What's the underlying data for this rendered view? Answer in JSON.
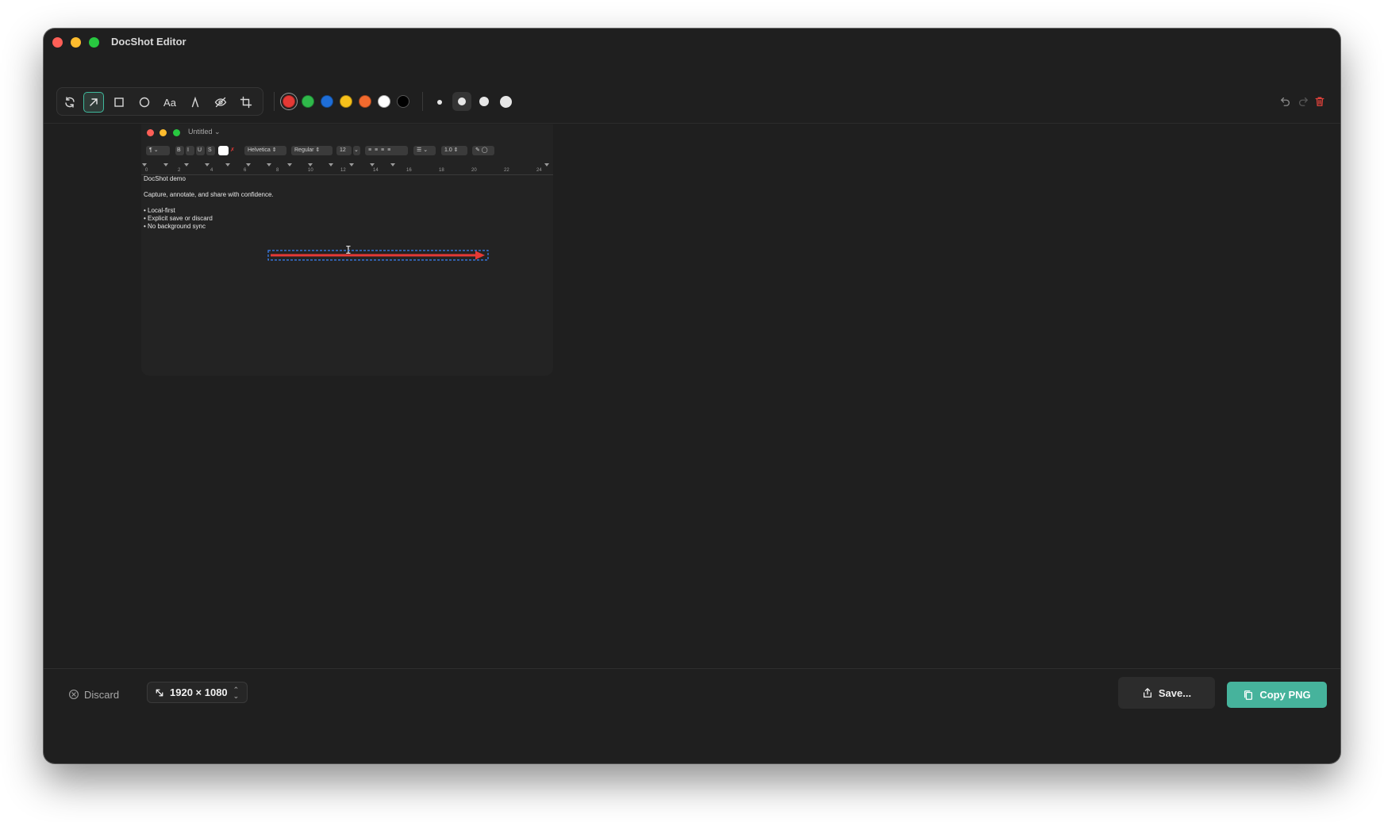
{
  "window": {
    "title": "DocShot Editor"
  },
  "toolbar": {
    "tools": [
      {
        "name": "rotate-icon",
        "active": false
      },
      {
        "name": "arrow-icon",
        "active": true
      },
      {
        "name": "rectangle-icon",
        "active": false
      },
      {
        "name": "ellipse-icon",
        "active": false
      },
      {
        "name": "text-icon",
        "label": "Aa",
        "active": false
      },
      {
        "name": "pen-icon",
        "active": false
      },
      {
        "name": "redact-eye-icon",
        "active": false
      },
      {
        "name": "crop-icon",
        "active": false
      }
    ],
    "colors": [
      {
        "name": "red",
        "hex": "#e53935",
        "selected": true
      },
      {
        "name": "green",
        "hex": "#2fb84a",
        "selected": false
      },
      {
        "name": "blue",
        "hex": "#1e6ed8",
        "selected": false
      },
      {
        "name": "yellow",
        "hex": "#f6c01a",
        "selected": false
      },
      {
        "name": "orange",
        "hex": "#f26a2e",
        "selected": false
      },
      {
        "name": "white",
        "hex": "#ffffff",
        "selected": false
      },
      {
        "name": "black",
        "hex": "#000000",
        "selected": false
      }
    ],
    "stroke_sizes": [
      "small",
      "medium",
      "large",
      "x-large"
    ],
    "selected_stroke": "medium",
    "right_icons": [
      "undo-icon",
      "redo-icon",
      "trash-icon"
    ]
  },
  "screenshot": {
    "doc_title": "Untitled",
    "toolbar": {
      "paragraph": "¶",
      "bold": "B",
      "italic": "I",
      "underline": "U",
      "strike": "S",
      "font": "Helvetica",
      "style": "Regular",
      "size": "12",
      "line_spacing": "1.0"
    },
    "ruler": [
      "0",
      "2",
      "4",
      "6",
      "8",
      "10",
      "12",
      "14",
      "16",
      "18",
      "20",
      "22",
      "24"
    ],
    "doc_lines": [
      "DocShot demo",
      "",
      "Capture, annotate, and share with confidence.",
      "",
      "• Local-first",
      "• Explicit save or discard",
      "• No background sync"
    ],
    "annotation": {
      "type": "arrow",
      "color": "#e53935",
      "selection_color": "#3b82f6"
    }
  },
  "bottombar": {
    "discard_label": "Discard",
    "dimensions": "1920 × 1080",
    "save_label": "Save...",
    "copy_label": "Copy PNG",
    "copy_color": "#46b39c"
  }
}
